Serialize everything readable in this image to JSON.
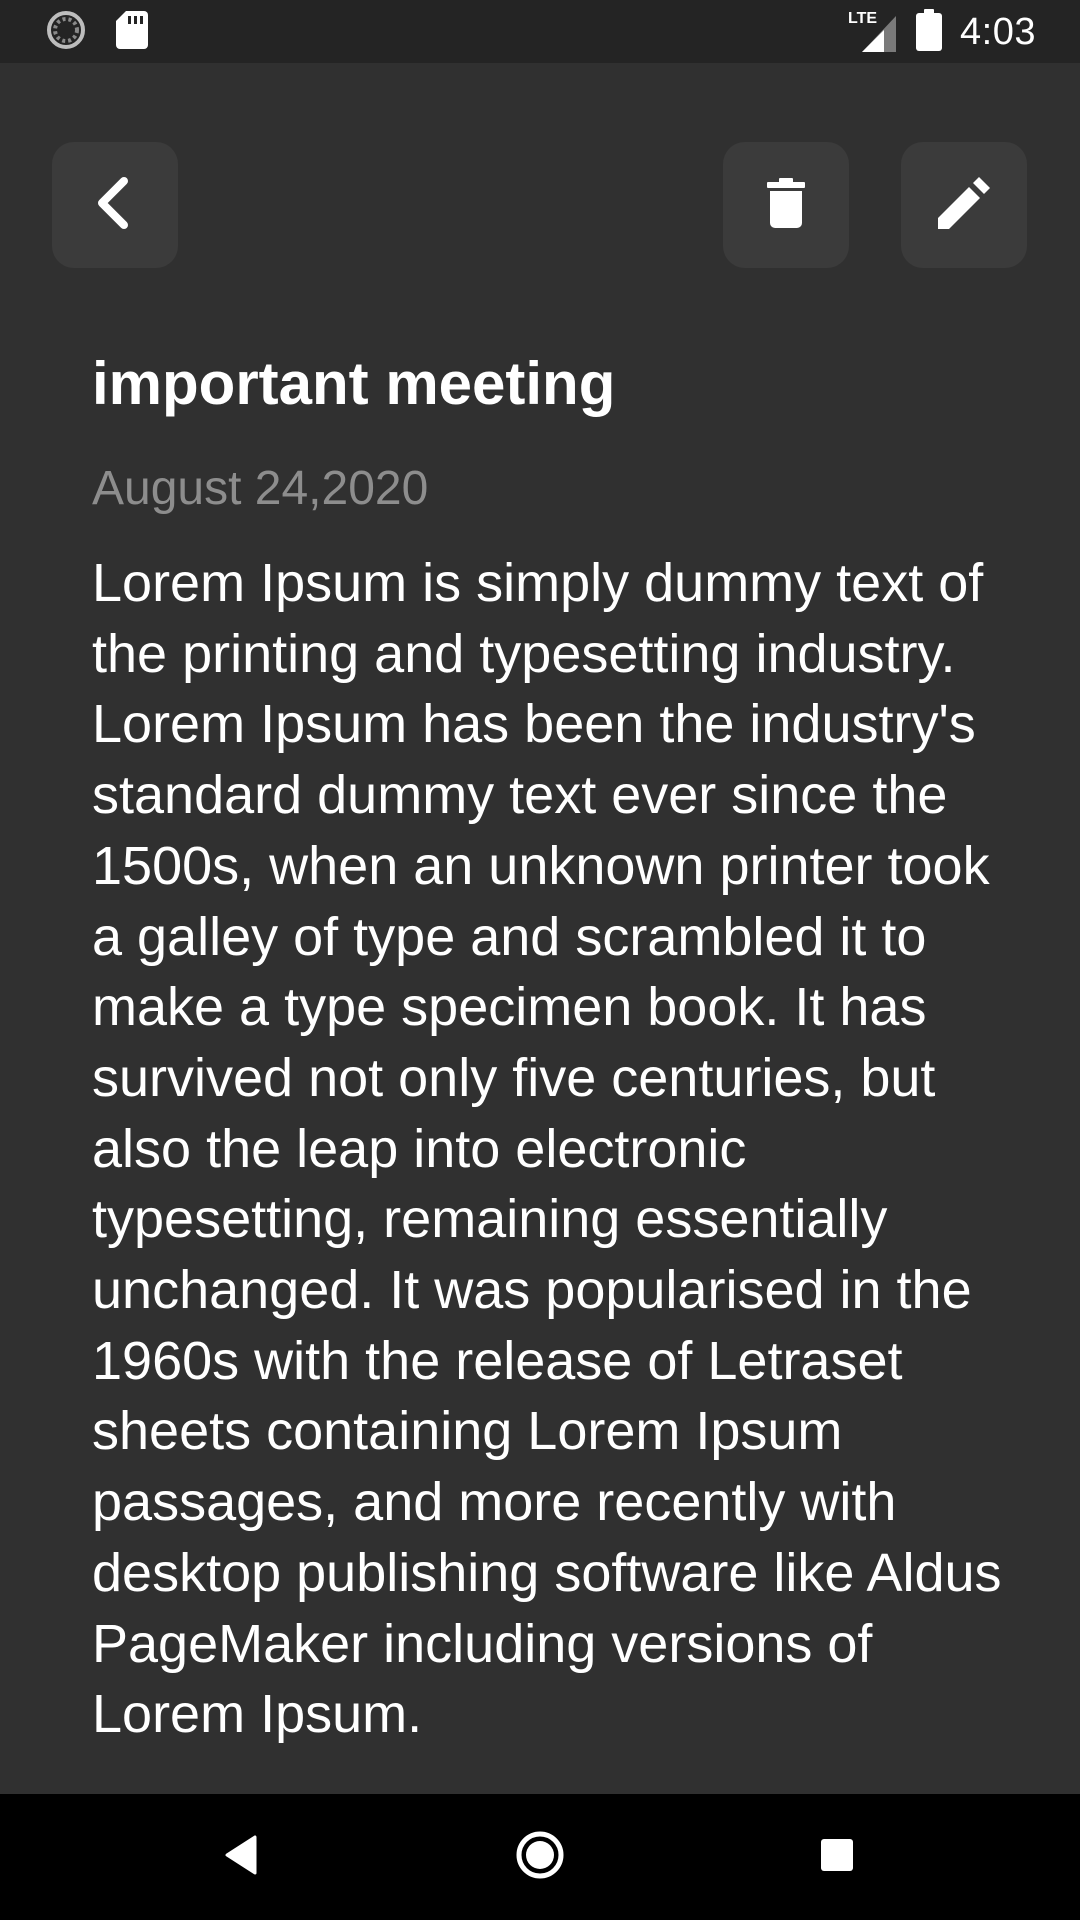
{
  "status_bar": {
    "time": "4:03",
    "network_label": "LTE",
    "icons": [
      "sync-icon",
      "sd-card-icon",
      "lte-signal-icon",
      "battery-icon"
    ]
  },
  "toolbar": {
    "back_icon": "chevron-left-icon",
    "delete_icon": "trash-icon",
    "edit_icon": "pencil-icon"
  },
  "note": {
    "title": "important meeting",
    "date": "August 24,2020",
    "body": "Lorem Ipsum is simply dummy text of the printing and typesetting industry. Lorem Ipsum has been the industry's standard dummy text ever since the 1500s, when an unknown printer took a galley of type and scrambled it to make a type specimen book. It has survived not only five centuries, but also the leap into electronic typesetting, remaining essentially unchanged. It was popularised in the 1960s with the release of Letraset sheets containing Lorem Ipsum passages, and more recently with desktop publishing software like Aldus PageMaker including versions of Lorem Ipsum."
  },
  "navigation": {
    "icons": [
      "nav-back-icon",
      "nav-home-icon",
      "nav-recents-icon"
    ]
  },
  "colors": {
    "background": "#303030",
    "status_bar": "#242424",
    "button_bg": "#3b3b3b",
    "date_text": "#8d8d8d",
    "nav_bar": "#000000"
  }
}
